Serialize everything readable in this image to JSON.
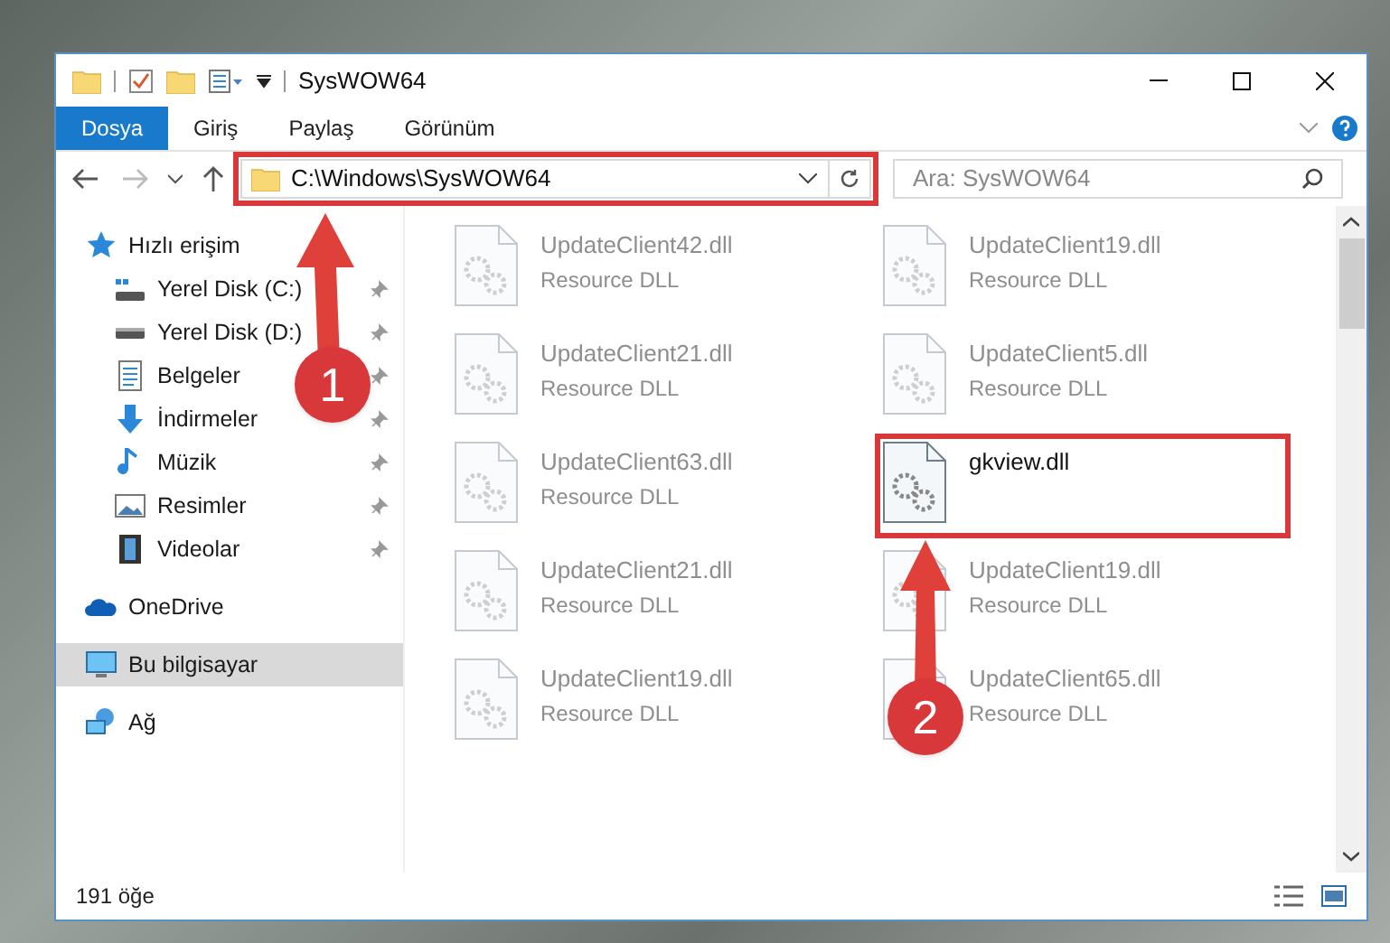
{
  "window": {
    "title": "SysWOW64"
  },
  "ribbon_tabs": [
    {
      "label": "Dosya",
      "selected": true
    },
    {
      "label": "Giriş",
      "selected": false
    },
    {
      "label": "Paylaş",
      "selected": false
    },
    {
      "label": "Görünüm",
      "selected": false
    }
  ],
  "address_bar": {
    "path": "C:\\Windows\\SysWOW64"
  },
  "search": {
    "placeholder": "Ara: SysWOW64"
  },
  "sidebar": {
    "items": [
      {
        "label": "Hızlı erişim",
        "kind": "quick-access",
        "selected": false,
        "children": [
          {
            "label": "Yerel Disk (C:)",
            "kind": "system-drive",
            "selected": false,
            "pinned": true
          },
          {
            "label": "Yerel Disk (D:)",
            "kind": "drive",
            "selected": false,
            "pinned": true
          },
          {
            "label": "Belgeler",
            "kind": "documents",
            "selected": false,
            "pinned": true
          },
          {
            "label": "İndirmeler",
            "kind": "downloads",
            "selected": false,
            "pinned": true
          },
          {
            "label": "Müzik",
            "kind": "music",
            "selected": false,
            "pinned": true
          },
          {
            "label": "Resimler",
            "kind": "pictures",
            "selected": false,
            "pinned": true
          },
          {
            "label": "Videolar",
            "kind": "videos",
            "selected": false,
            "pinned": true
          }
        ]
      },
      {
        "label": "OneDrive",
        "kind": "cloud",
        "selected": false
      },
      {
        "label": "Bu bilgisayar",
        "kind": "computer",
        "selected": true
      },
      {
        "label": "Ağ",
        "kind": "network",
        "selected": false
      }
    ]
  },
  "files": [
    {
      "name": "UpdateClient42.dll",
      "type": "Resource DLL",
      "dimmed": true
    },
    {
      "name": "UpdateClient19.dll",
      "type": "Resource DLL",
      "dimmed": true
    },
    {
      "name": "UpdateClient21.dll",
      "type": "Resource DLL",
      "dimmed": true
    },
    {
      "name": "UpdateClient5.dll",
      "type": "Resource DLL",
      "dimmed": true
    },
    {
      "name": "UpdateClient63.dll",
      "type": "Resource DLL",
      "dimmed": true
    },
    {
      "name": "gkview.dll",
      "dimmed": false
    },
    {
      "name": "UpdateClient21.dll",
      "type": "Resource DLL",
      "dimmed": true
    },
    {
      "name": "UpdateClient19.dll",
      "type": "Resource DLL",
      "dimmed": true
    },
    {
      "name": "UpdateClient19.dll",
      "type": "Resource DLL",
      "dimmed": true
    },
    {
      "name": "UpdateClient65.dll",
      "type": "Resource DLL",
      "dimmed": true
    }
  ],
  "status_bar": {
    "item_count": "191 öğe"
  },
  "annotations": [
    {
      "label": "1"
    },
    {
      "label": "2"
    }
  ]
}
